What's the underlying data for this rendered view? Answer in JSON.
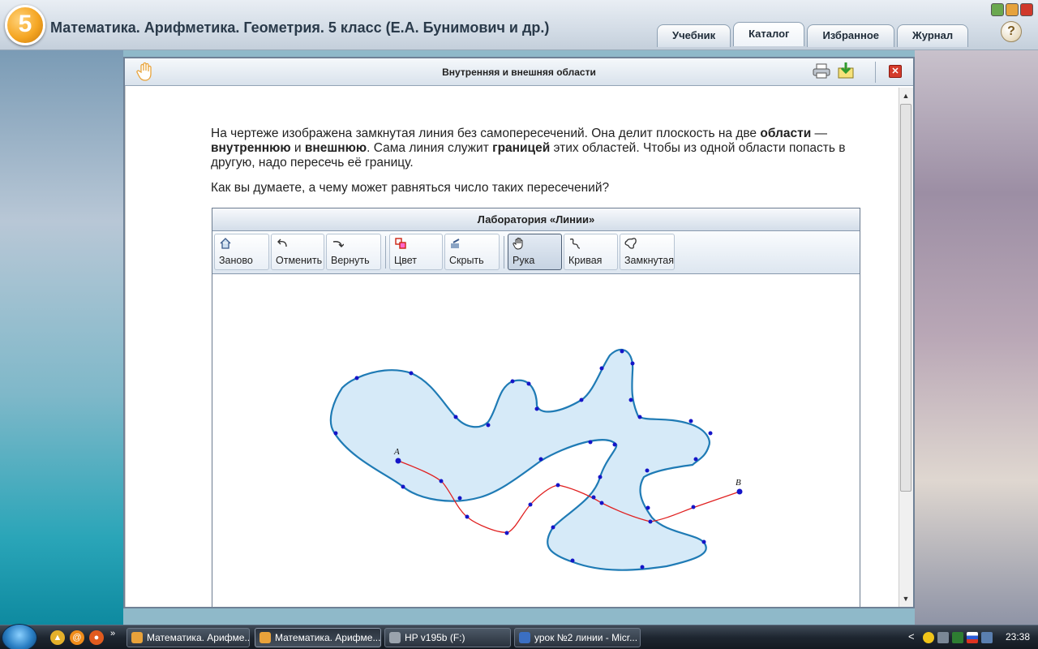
{
  "app": {
    "grade": "5",
    "title": "Математика. Арифметика. Геометрия. 5 класс (Е.А. Бунимович и др.)",
    "tabs": [
      {
        "label": "Учебник",
        "active": false
      },
      {
        "label": "Каталог",
        "active": true
      },
      {
        "label": "Избранное",
        "active": false
      },
      {
        "label": "Журнал",
        "active": false
      }
    ],
    "help_label": "?"
  },
  "content": {
    "title": "Внутренняя и внешняя области",
    "paragraph1": {
      "t1": "На чертеже изображена замкнутая линия без самопересечений. Она делит плоскость на две ",
      "b1": "области",
      "t2": " — ",
      "b2": "внутреннюю",
      "t3": " и ",
      "b3": "внешнюю",
      "t4": ". Сама линия служит ",
      "b4": "границей",
      "t5": " этих областей. Чтобы из одной области попасть в другую, надо пересечь её границу."
    },
    "paragraph2": "Как вы думаете, а чему может равняться число таких пересечений?"
  },
  "lab": {
    "title": "Лаборатория «Линии»",
    "tools": [
      {
        "label": "Заново",
        "icon": "home-icon"
      },
      {
        "label": "Отменить",
        "icon": "undo-icon"
      },
      {
        "label": "Вернуть",
        "icon": "redo-icon"
      },
      {
        "label": "Цвет",
        "icon": "color-icon"
      },
      {
        "label": "Скрыть",
        "icon": "hide-icon"
      },
      {
        "label": "Рука",
        "icon": "hand-icon",
        "active": true
      },
      {
        "label": "Кривая",
        "icon": "curve-icon"
      },
      {
        "label": "Замкнутая",
        "icon": "closed-curve-icon"
      }
    ],
    "point_a": "A",
    "point_b": "B",
    "colors": {
      "region_fill": "#d6eaf8",
      "region_stroke": "#1f7bb5",
      "path_stroke": "#e02020",
      "point": "#1515c8"
    }
  },
  "taskbar": {
    "buttons": [
      {
        "label": "Математика. Арифме...",
        "active": false
      },
      {
        "label": "Математика. Арифме...",
        "active": true
      },
      {
        "label": "HP v195b (F:)",
        "active": false
      },
      {
        "label": "урок №2 линии - Micr...",
        "active": false
      }
    ],
    "more": "»",
    "tray_arrow": "<",
    "clock": "23:38"
  }
}
